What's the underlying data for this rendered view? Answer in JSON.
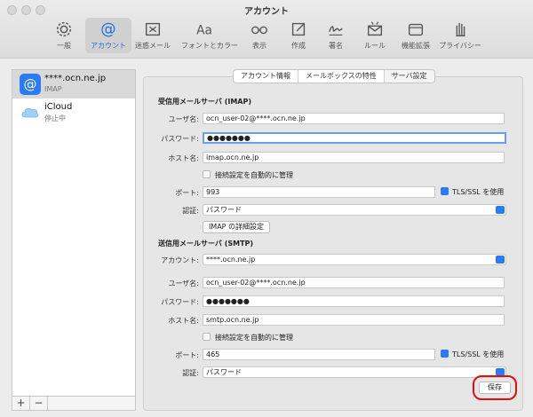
{
  "window": {
    "title": "アカウント"
  },
  "toolbar": [
    {
      "label": "一般",
      "icon": "gear-icon"
    },
    {
      "label": "アカウント",
      "icon": "at-sign-icon"
    },
    {
      "label": "迷惑メール",
      "icon": "junk-tray-icon"
    },
    {
      "label": "フォントとカラー",
      "icon": "font-aa-icon"
    },
    {
      "label": "表示",
      "icon": "glasses-icon"
    },
    {
      "label": "作成",
      "icon": "compose-icon"
    },
    {
      "label": "署名",
      "icon": "signature-icon"
    },
    {
      "label": "ルール",
      "icon": "rules-envelope-icon"
    },
    {
      "label": "機能拡張",
      "icon": "extensions-icon"
    },
    {
      "label": "プライバシー",
      "icon": "privacy-hand-icon"
    }
  ],
  "sidebar": {
    "accounts": [
      {
        "name": "****.ocn.ne.jp",
        "type": "IMAP",
        "icon_text": "@"
      },
      {
        "name": "iCloud",
        "status": "停止中"
      }
    ],
    "add_label": "+",
    "remove_label": "−"
  },
  "tabs": [
    "アカウント情報",
    "メールボックスの特性",
    "サーバ設定"
  ],
  "incoming": {
    "section_title": "受信用メールサーバ (IMAP)",
    "username_label": "ユーザ名:",
    "username": "ocn_user-02@****.ocn.ne.jp",
    "password_label": "パスワード:",
    "password": "●●●●●●●",
    "host_label": "ホスト名:",
    "host": "imap.ocn.ne.jp",
    "auto_manage_label": "接続設定を自動的に管理",
    "port_label": "ポート:",
    "port": "993",
    "tls_label": "TLS/SSL を使用",
    "auth_label": "認証:",
    "auth": "パスワード",
    "advanced_button": "IMAP の詳細設定"
  },
  "outgoing": {
    "section_title": "送信用メールサーバ (SMTP)",
    "account_label": "アカウント:",
    "account": "****.ocn.ne.jp",
    "username_label": "ユーザ名:",
    "username": "ocn_user-02@****.ocn.ne.jp",
    "password_label": "パスワード:",
    "password": "●●●●●●●",
    "host_label": "ホスト名:",
    "host": "smtp.ocn.ne.jp",
    "auto_manage_label": "接続設定を自動的に管理",
    "port_label": "ポート:",
    "port": "465",
    "tls_label": "TLS/SSL を使用",
    "auth_label": "認証:",
    "auth": "パスワード"
  },
  "save_button": "保存",
  "colors": {
    "accent": "#2a7bf5",
    "highlight": "#e01010"
  }
}
